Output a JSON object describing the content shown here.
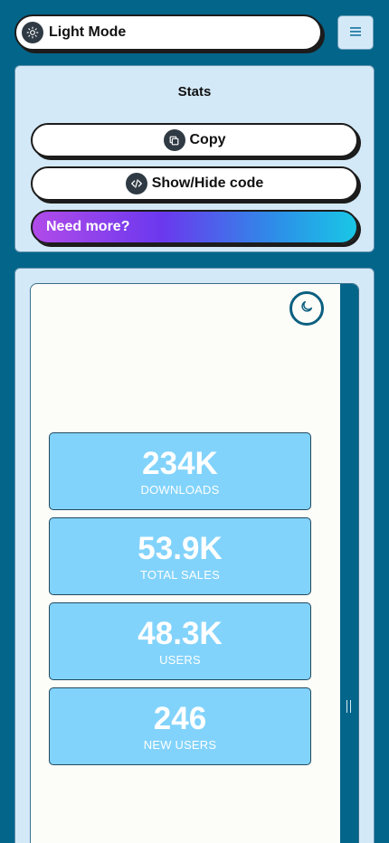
{
  "header": {
    "mode_label": "Light Mode",
    "mode_icon": "sun-icon",
    "menu_icon": "hamburger-menu-icon"
  },
  "panel": {
    "title": "Stats",
    "buttons": {
      "copy": {
        "label": "Copy",
        "icon": "copy-icon"
      },
      "code": {
        "label": "Show/Hide code",
        "icon": "code-icon"
      },
      "more": {
        "label": "Need more?"
      }
    }
  },
  "preview": {
    "theme_toggle_icon": "moon-icon",
    "stats": [
      {
        "value": "234K",
        "label": "DOWNLOADS"
      },
      {
        "value": "53.9K",
        "label": "TOTAL SALES"
      },
      {
        "value": "48.3K",
        "label": "USERS"
      },
      {
        "value": "246",
        "label": "NEW USERS"
      }
    ]
  },
  "colors": {
    "background": "#03658a",
    "panel": "#d4e9f7",
    "card": "#82d3fb",
    "gradient_start": "#b14be9",
    "gradient_end": "#19c7e6"
  }
}
